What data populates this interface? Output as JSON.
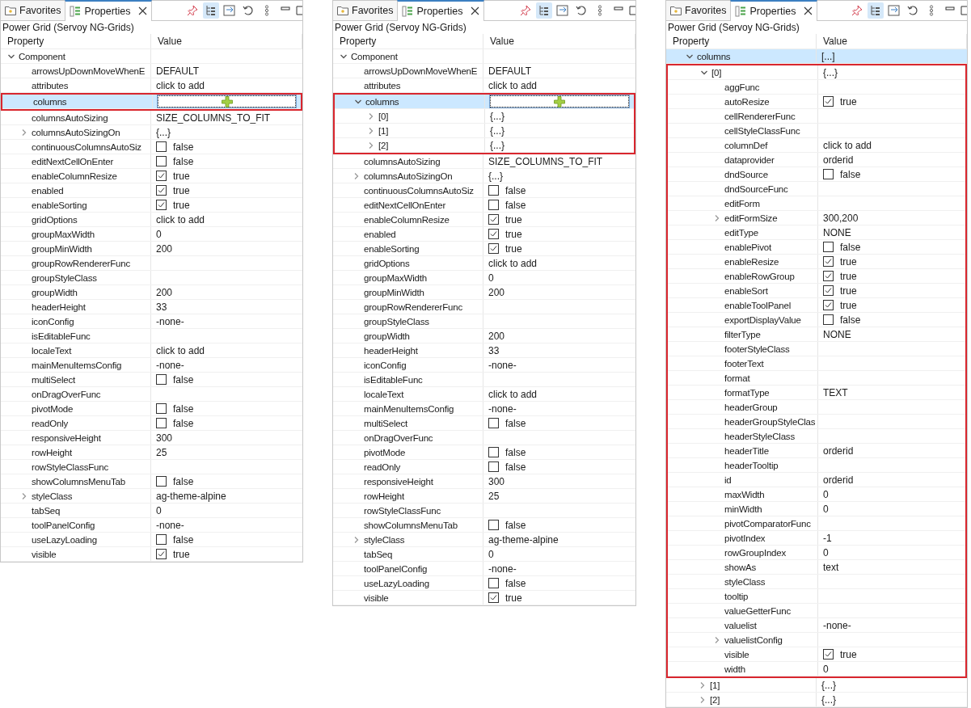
{
  "panels": [
    {
      "tabs": [
        {
          "label": "Favorites",
          "kind": "favorites",
          "selected": false
        },
        {
          "label": "Properties",
          "kind": "properties",
          "selected": true
        }
      ],
      "title": "Power Grid (Servoy NG-Grids)",
      "columns": [
        "Property",
        "Value"
      ],
      "tree": [
        {
          "name": "Component",
          "expanded": true,
          "selected": false,
          "children": [
            {
              "name": "arrowsUpDownMoveWhenE",
              "kind": "text",
              "value": "DEFAULT",
              "selected": false
            },
            {
              "name": "attributes",
              "kind": "text",
              "value": "click to add",
              "selected": false
            },
            {
              "name": "columns",
              "kind": "add",
              "selected": true,
              "highlight": true
            },
            {
              "name": "columnsAutoSizing",
              "kind": "text",
              "value": "SIZE_COLUMNS_TO_FIT",
              "selected": false
            },
            {
              "name": "columnsAutoSizingOn",
              "kind": "text",
              "value": "{...}",
              "expanded": false,
              "selected": false
            },
            {
              "name": "continuousColumnsAutoSiz",
              "kind": "check",
              "checked": false,
              "value": "false",
              "selected": false
            },
            {
              "name": "editNextCellOnEnter",
              "kind": "check",
              "checked": false,
              "value": "false",
              "selected": false
            },
            {
              "name": "enableColumnResize",
              "kind": "check",
              "checked": true,
              "value": "true",
              "selected": false
            },
            {
              "name": "enabled",
              "kind": "check",
              "checked": true,
              "value": "true",
              "selected": false
            },
            {
              "name": "enableSorting",
              "kind": "check",
              "checked": true,
              "value": "true",
              "selected": false
            },
            {
              "name": "gridOptions",
              "kind": "text",
              "value": "click to add",
              "selected": false
            },
            {
              "name": "groupMaxWidth",
              "kind": "text",
              "value": "0",
              "selected": false
            },
            {
              "name": "groupMinWidth",
              "kind": "text",
              "value": "200",
              "selected": false
            },
            {
              "name": "groupRowRendererFunc",
              "kind": "text",
              "selected": false
            },
            {
              "name": "groupStyleClass",
              "kind": "text",
              "selected": false
            },
            {
              "name": "groupWidth",
              "kind": "text",
              "value": "200",
              "selected": false
            },
            {
              "name": "headerHeight",
              "kind": "text",
              "value": "33",
              "selected": false
            },
            {
              "name": "iconConfig",
              "kind": "text",
              "value": "-none-",
              "selected": false
            },
            {
              "name": "isEditableFunc",
              "kind": "text",
              "selected": false
            },
            {
              "name": "localeText",
              "kind": "text",
              "value": "click to add",
              "selected": false
            },
            {
              "name": "mainMenuItemsConfig",
              "kind": "text",
              "value": "-none-",
              "selected": false
            },
            {
              "name": "multiSelect",
              "kind": "check",
              "checked": false,
              "value": "false",
              "selected": false
            },
            {
              "name": "onDragOverFunc",
              "kind": "text",
              "selected": false
            },
            {
              "name": "pivotMode",
              "kind": "check",
              "checked": false,
              "value": "false",
              "selected": false
            },
            {
              "name": "readOnly",
              "kind": "check",
              "checked": false,
              "value": "false",
              "selected": false
            },
            {
              "name": "responsiveHeight",
              "kind": "text",
              "value": "300",
              "selected": false
            },
            {
              "name": "rowHeight",
              "kind": "text",
              "value": "25",
              "selected": false
            },
            {
              "name": "rowStyleClassFunc",
              "kind": "text",
              "selected": false
            },
            {
              "name": "showColumnsMenuTab",
              "kind": "check",
              "checked": false,
              "value": "false",
              "selected": false
            },
            {
              "name": "styleClass",
              "kind": "text",
              "value": "ag-theme-alpine",
              "expanded": false,
              "selected": false
            },
            {
              "name": "tabSeq",
              "kind": "text",
              "value": "0",
              "selected": false
            },
            {
              "name": "toolPanelConfig",
              "kind": "text",
              "value": "-none-",
              "selected": false
            },
            {
              "name": "useLazyLoading",
              "kind": "check",
              "checked": false,
              "value": "false",
              "selected": false
            },
            {
              "name": "visible",
              "kind": "check",
              "checked": true,
              "value": "true",
              "selected": false
            }
          ]
        }
      ]
    },
    {
      "tabs": [
        {
          "label": "Favorites",
          "kind": "favorites",
          "selected": false
        },
        {
          "label": "Properties",
          "kind": "properties",
          "selected": true
        }
      ],
      "title": "Power Grid (Servoy NG-Grids)",
      "columns": [
        "Property",
        "Value"
      ],
      "tree": [
        {
          "name": "Component",
          "expanded": true,
          "selected": false,
          "children": [
            {
              "name": "arrowsUpDownMoveWhenE",
              "kind": "text",
              "value": "DEFAULT",
              "selected": false
            },
            {
              "name": "attributes",
              "kind": "text",
              "value": "click to add",
              "selected": false
            },
            {
              "name": "columns",
              "kind": "add",
              "expanded": true,
              "selected": true,
              "highlight": true,
              "children": [
                {
                  "name": "[0]",
                  "kind": "text",
                  "value": "{...}",
                  "expanded": false,
                  "selected": false
                },
                {
                  "name": "[1]",
                  "kind": "text",
                  "value": "{...}",
                  "expanded": false,
                  "selected": false
                },
                {
                  "name": "[2]",
                  "kind": "text",
                  "value": "{...}",
                  "expanded": false,
                  "selected": false
                }
              ]
            },
            {
              "name": "columnsAutoSizing",
              "kind": "text",
              "value": "SIZE_COLUMNS_TO_FIT",
              "selected": false
            },
            {
              "name": "columnsAutoSizingOn",
              "kind": "text",
              "value": "{...}",
              "expanded": false,
              "selected": false
            },
            {
              "name": "continuousColumnsAutoSiz",
              "kind": "check",
              "checked": false,
              "value": "false",
              "selected": false
            },
            {
              "name": "editNextCellOnEnter",
              "kind": "check",
              "checked": false,
              "value": "false",
              "selected": false
            },
            {
              "name": "enableColumnResize",
              "kind": "check",
              "checked": true,
              "value": "true",
              "selected": false
            },
            {
              "name": "enabled",
              "kind": "check",
              "checked": true,
              "value": "true",
              "selected": false
            },
            {
              "name": "enableSorting",
              "kind": "check",
              "checked": true,
              "value": "true",
              "selected": false
            },
            {
              "name": "gridOptions",
              "kind": "text",
              "value": "click to add",
              "selected": false
            },
            {
              "name": "groupMaxWidth",
              "kind": "text",
              "value": "0",
              "selected": false
            },
            {
              "name": "groupMinWidth",
              "kind": "text",
              "value": "200",
              "selected": false
            },
            {
              "name": "groupRowRendererFunc",
              "kind": "text",
              "selected": false
            },
            {
              "name": "groupStyleClass",
              "kind": "text",
              "selected": false
            },
            {
              "name": "groupWidth",
              "kind": "text",
              "value": "200",
              "selected": false
            },
            {
              "name": "headerHeight",
              "kind": "text",
              "value": "33",
              "selected": false
            },
            {
              "name": "iconConfig",
              "kind": "text",
              "value": "-none-",
              "selected": false
            },
            {
              "name": "isEditableFunc",
              "kind": "text",
              "selected": false
            },
            {
              "name": "localeText",
              "kind": "text",
              "value": "click to add",
              "selected": false
            },
            {
              "name": "mainMenuItemsConfig",
              "kind": "text",
              "value": "-none-",
              "selected": false
            },
            {
              "name": "multiSelect",
              "kind": "check",
              "checked": false,
              "value": "false",
              "selected": false
            },
            {
              "name": "onDragOverFunc",
              "kind": "text",
              "selected": false
            },
            {
              "name": "pivotMode",
              "kind": "check",
              "checked": false,
              "value": "false",
              "selected": false
            },
            {
              "name": "readOnly",
              "kind": "check",
              "checked": false,
              "value": "false",
              "selected": false
            },
            {
              "name": "responsiveHeight",
              "kind": "text",
              "value": "300",
              "selected": false
            },
            {
              "name": "rowHeight",
              "kind": "text",
              "value": "25",
              "selected": false
            },
            {
              "name": "rowStyleClassFunc",
              "kind": "text",
              "selected": false
            },
            {
              "name": "showColumnsMenuTab",
              "kind": "check",
              "checked": false,
              "value": "false",
              "selected": false
            },
            {
              "name": "styleClass",
              "kind": "text",
              "value": "ag-theme-alpine",
              "expanded": false,
              "selected": false
            },
            {
              "name": "tabSeq",
              "kind": "text",
              "value": "0",
              "selected": false
            },
            {
              "name": "toolPanelConfig",
              "kind": "text",
              "value": "-none-",
              "selected": false
            },
            {
              "name": "useLazyLoading",
              "kind": "check",
              "checked": false,
              "value": "false",
              "selected": false
            },
            {
              "name": "visible",
              "kind": "check",
              "checked": true,
              "value": "true",
              "selected": false
            }
          ]
        }
      ]
    },
    {
      "tabs": [
        {
          "label": "Favorites",
          "kind": "favorites",
          "selected": false
        },
        {
          "label": "Properties",
          "kind": "properties",
          "selected": true
        }
      ],
      "title": "Power Grid (Servoy NG-Grids)",
      "columns": [
        "Property",
        "Value"
      ],
      "tree": [
        {
          "children": [
            {
              "name": "columns",
              "kind": "text",
              "value": "[...]",
              "expanded": true,
              "selected": true,
              "children": [
                {
                  "name": "[0]",
                  "kind": "text",
                  "value": "{...}",
                  "expanded": true,
                  "selected": false,
                  "highlight": true,
                  "children": [
                    {
                      "name": "aggFunc",
                      "kind": "text",
                      "selected": false
                    },
                    {
                      "name": "autoResize",
                      "kind": "check",
                      "checked": true,
                      "value": "true",
                      "selected": false
                    },
                    {
                      "name": "cellRendererFunc",
                      "kind": "text",
                      "selected": false
                    },
                    {
                      "name": "cellStyleClassFunc",
                      "kind": "text",
                      "selected": false
                    },
                    {
                      "name": "columnDef",
                      "kind": "text",
                      "value": "click to add",
                      "selected": false
                    },
                    {
                      "name": "dataprovider",
                      "kind": "text",
                      "value": "orderid",
                      "selected": false
                    },
                    {
                      "name": "dndSource",
                      "kind": "check",
                      "checked": false,
                      "value": "false",
                      "selected": false
                    },
                    {
                      "name": "dndSourceFunc",
                      "kind": "text",
                      "selected": false
                    },
                    {
                      "name": "editForm",
                      "kind": "text",
                      "selected": false
                    },
                    {
                      "name": "editFormSize",
                      "kind": "text",
                      "value": "300,200",
                      "expanded": false,
                      "selected": false
                    },
                    {
                      "name": "editType",
                      "kind": "text",
                      "value": "NONE",
                      "selected": false
                    },
                    {
                      "name": "enablePivot",
                      "kind": "check",
                      "checked": false,
                      "value": "false",
                      "selected": false
                    },
                    {
                      "name": "enableResize",
                      "kind": "check",
                      "checked": true,
                      "value": "true",
                      "selected": false
                    },
                    {
                      "name": "enableRowGroup",
                      "kind": "check",
                      "checked": true,
                      "value": "true",
                      "selected": false
                    },
                    {
                      "name": "enableSort",
                      "kind": "check",
                      "checked": true,
                      "value": "true",
                      "selected": false
                    },
                    {
                      "name": "enableToolPanel",
                      "kind": "check",
                      "checked": true,
                      "value": "true",
                      "selected": false
                    },
                    {
                      "name": "exportDisplayValue",
                      "kind": "check",
                      "checked": false,
                      "value": "false",
                      "selected": false
                    },
                    {
                      "name": "filterType",
                      "kind": "text",
                      "value": "NONE",
                      "selected": false
                    },
                    {
                      "name": "footerStyleClass",
                      "kind": "text",
                      "selected": false
                    },
                    {
                      "name": "footerText",
                      "kind": "text",
                      "selected": false
                    },
                    {
                      "name": "format",
                      "kind": "text",
                      "selected": false
                    },
                    {
                      "name": "formatType",
                      "kind": "text",
                      "value": "TEXT",
                      "selected": false
                    },
                    {
                      "name": "headerGroup",
                      "kind": "text",
                      "selected": false
                    },
                    {
                      "name": "headerGroupStyleClas",
                      "kind": "text",
                      "selected": false
                    },
                    {
                      "name": "headerStyleClass",
                      "kind": "text",
                      "selected": false
                    },
                    {
                      "name": "headerTitle",
                      "kind": "text",
                      "value": "orderid",
                      "selected": false
                    },
                    {
                      "name": "headerTooltip",
                      "kind": "text",
                      "selected": false
                    },
                    {
                      "name": "id",
                      "kind": "text",
                      "value": "orderid",
                      "selected": false
                    },
                    {
                      "name": "maxWidth",
                      "kind": "text",
                      "value": "0",
                      "selected": false
                    },
                    {
                      "name": "minWidth",
                      "kind": "text",
                      "value": "0",
                      "selected": false
                    },
                    {
                      "name": "pivotComparatorFunc",
                      "kind": "text",
                      "selected": false
                    },
                    {
                      "name": "pivotIndex",
                      "kind": "text",
                      "value": "-1",
                      "selected": false
                    },
                    {
                      "name": "rowGroupIndex",
                      "kind": "text",
                      "value": "0",
                      "selected": false
                    },
                    {
                      "name": "showAs",
                      "kind": "text",
                      "value": "text",
                      "selected": false
                    },
                    {
                      "name": "styleClass",
                      "kind": "text",
                      "selected": false
                    },
                    {
                      "name": "tooltip",
                      "kind": "text",
                      "selected": false
                    },
                    {
                      "name": "valueGetterFunc",
                      "kind": "text",
                      "selected": false
                    },
                    {
                      "name": "valuelist",
                      "kind": "text",
                      "value": "-none-",
                      "selected": false
                    },
                    {
                      "name": "valuelistConfig",
                      "kind": "text",
                      "expanded": false,
                      "selected": false
                    },
                    {
                      "name": "visible",
                      "kind": "check",
                      "checked": true,
                      "value": "true",
                      "selected": false
                    },
                    {
                      "name": "width",
                      "kind": "text",
                      "value": "0",
                      "selected": false
                    }
                  ]
                },
                {
                  "name": "[1]",
                  "kind": "text",
                  "value": "{...}",
                  "expanded": false,
                  "selected": false
                },
                {
                  "name": "[2]",
                  "kind": "text",
                  "value": "{...}",
                  "expanded": false,
                  "selected": false
                }
              ]
            }
          ]
        }
      ]
    }
  ]
}
